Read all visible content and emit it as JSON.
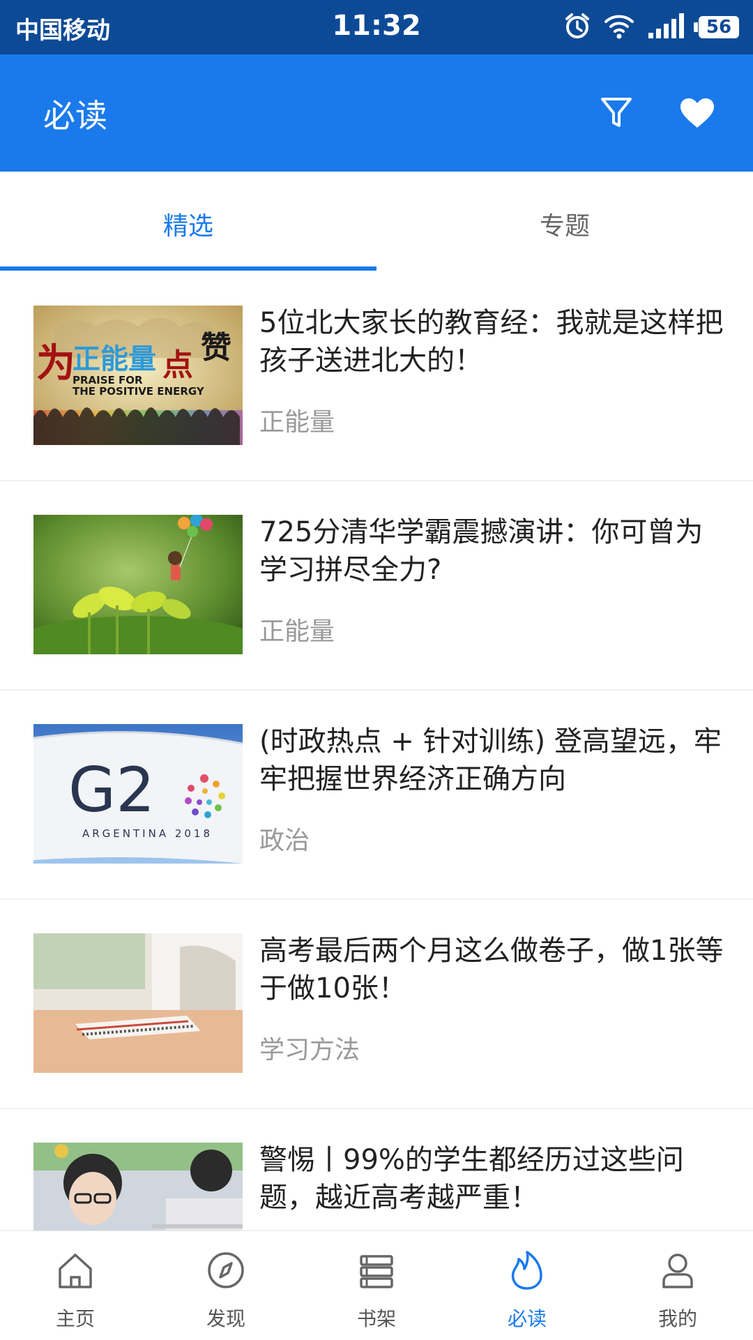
{
  "status_bar": {
    "carrier": "中国移动",
    "time": "11:32",
    "battery": "56",
    "icons": [
      "alarm-icon",
      "wifi-icon",
      "signal-icon",
      "battery-icon"
    ]
  },
  "app_bar": {
    "title": "必读",
    "actions": [
      "filter-icon",
      "heart-icon"
    ]
  },
  "tabs": [
    {
      "label": "精选",
      "active": true
    },
    {
      "label": "专题",
      "active": false
    }
  ],
  "articles": [
    {
      "title": "5位北大家长的教育经：我就是这样把孩子送进北大的！",
      "tag": "正能量",
      "image_text_1": "为正能量点赞",
      "image_text_2": "PRAISE FOR",
      "image_text_3": "THE POSITIVE ENERGY"
    },
    {
      "title": "725分清华学霸震撼演讲：你可曾为学习拼尽全力?",
      "tag": "正能量"
    },
    {
      "title": "(时政热点 + 针对训练) 登高望远，牢牢把握世界经济正确方向",
      "tag": "政治",
      "image_text_1": "G20",
      "image_text_2": "ARGENTINA 2018"
    },
    {
      "title": "高考最后两个月这么做卷子，做1张等于做10张！",
      "tag": "学习方法"
    },
    {
      "title": "警惕丨99%的学生都经历过这些问题，越近高考越严重！",
      "tag": ""
    }
  ],
  "bottom_nav": [
    {
      "label": "主页",
      "icon": "home-icon",
      "active": false
    },
    {
      "label": "发现",
      "icon": "compass-icon",
      "active": false
    },
    {
      "label": "书架",
      "icon": "bookshelf-icon",
      "active": false
    },
    {
      "label": "必读",
      "icon": "flame-icon",
      "active": true
    },
    {
      "label": "我的",
      "icon": "user-icon",
      "active": false
    }
  ],
  "colors": {
    "status_bar": "#0d4a96",
    "primary": "#1a7aeb",
    "tag_text": "#999999"
  }
}
